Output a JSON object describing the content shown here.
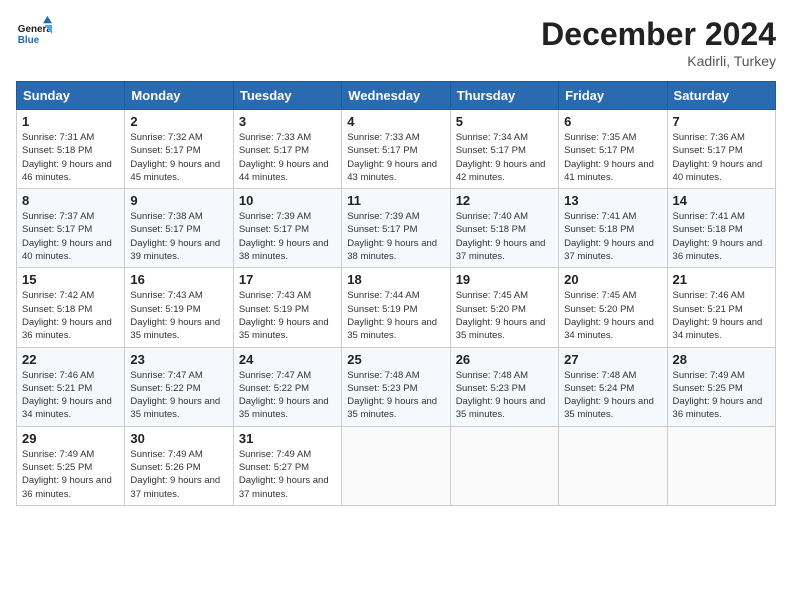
{
  "header": {
    "logo_line1": "General",
    "logo_line2": "Blue",
    "month": "December 2024",
    "location": "Kadirli, Turkey"
  },
  "days_of_week": [
    "Sunday",
    "Monday",
    "Tuesday",
    "Wednesday",
    "Thursday",
    "Friday",
    "Saturday"
  ],
  "weeks": [
    [
      {
        "day": "1",
        "sunrise": "Sunrise: 7:31 AM",
        "sunset": "Sunset: 5:18 PM",
        "daylight": "Daylight: 9 hours and 46 minutes."
      },
      {
        "day": "2",
        "sunrise": "Sunrise: 7:32 AM",
        "sunset": "Sunset: 5:17 PM",
        "daylight": "Daylight: 9 hours and 45 minutes."
      },
      {
        "day": "3",
        "sunrise": "Sunrise: 7:33 AM",
        "sunset": "Sunset: 5:17 PM",
        "daylight": "Daylight: 9 hours and 44 minutes."
      },
      {
        "day": "4",
        "sunrise": "Sunrise: 7:33 AM",
        "sunset": "Sunset: 5:17 PM",
        "daylight": "Daylight: 9 hours and 43 minutes."
      },
      {
        "day": "5",
        "sunrise": "Sunrise: 7:34 AM",
        "sunset": "Sunset: 5:17 PM",
        "daylight": "Daylight: 9 hours and 42 minutes."
      },
      {
        "day": "6",
        "sunrise": "Sunrise: 7:35 AM",
        "sunset": "Sunset: 5:17 PM",
        "daylight": "Daylight: 9 hours and 41 minutes."
      },
      {
        "day": "7",
        "sunrise": "Sunrise: 7:36 AM",
        "sunset": "Sunset: 5:17 PM",
        "daylight": "Daylight: 9 hours and 40 minutes."
      }
    ],
    [
      {
        "day": "8",
        "sunrise": "Sunrise: 7:37 AM",
        "sunset": "Sunset: 5:17 PM",
        "daylight": "Daylight: 9 hours and 40 minutes."
      },
      {
        "day": "9",
        "sunrise": "Sunrise: 7:38 AM",
        "sunset": "Sunset: 5:17 PM",
        "daylight": "Daylight: 9 hours and 39 minutes."
      },
      {
        "day": "10",
        "sunrise": "Sunrise: 7:39 AM",
        "sunset": "Sunset: 5:17 PM",
        "daylight": "Daylight: 9 hours and 38 minutes."
      },
      {
        "day": "11",
        "sunrise": "Sunrise: 7:39 AM",
        "sunset": "Sunset: 5:17 PM",
        "daylight": "Daylight: 9 hours and 38 minutes."
      },
      {
        "day": "12",
        "sunrise": "Sunrise: 7:40 AM",
        "sunset": "Sunset: 5:18 PM",
        "daylight": "Daylight: 9 hours and 37 minutes."
      },
      {
        "day": "13",
        "sunrise": "Sunrise: 7:41 AM",
        "sunset": "Sunset: 5:18 PM",
        "daylight": "Daylight: 9 hours and 37 minutes."
      },
      {
        "day": "14",
        "sunrise": "Sunrise: 7:41 AM",
        "sunset": "Sunset: 5:18 PM",
        "daylight": "Daylight: 9 hours and 36 minutes."
      }
    ],
    [
      {
        "day": "15",
        "sunrise": "Sunrise: 7:42 AM",
        "sunset": "Sunset: 5:18 PM",
        "daylight": "Daylight: 9 hours and 36 minutes."
      },
      {
        "day": "16",
        "sunrise": "Sunrise: 7:43 AM",
        "sunset": "Sunset: 5:19 PM",
        "daylight": "Daylight: 9 hours and 35 minutes."
      },
      {
        "day": "17",
        "sunrise": "Sunrise: 7:43 AM",
        "sunset": "Sunset: 5:19 PM",
        "daylight": "Daylight: 9 hours and 35 minutes."
      },
      {
        "day": "18",
        "sunrise": "Sunrise: 7:44 AM",
        "sunset": "Sunset: 5:19 PM",
        "daylight": "Daylight: 9 hours and 35 minutes."
      },
      {
        "day": "19",
        "sunrise": "Sunrise: 7:45 AM",
        "sunset": "Sunset: 5:20 PM",
        "daylight": "Daylight: 9 hours and 35 minutes."
      },
      {
        "day": "20",
        "sunrise": "Sunrise: 7:45 AM",
        "sunset": "Sunset: 5:20 PM",
        "daylight": "Daylight: 9 hours and 34 minutes."
      },
      {
        "day": "21",
        "sunrise": "Sunrise: 7:46 AM",
        "sunset": "Sunset: 5:21 PM",
        "daylight": "Daylight: 9 hours and 34 minutes."
      }
    ],
    [
      {
        "day": "22",
        "sunrise": "Sunrise: 7:46 AM",
        "sunset": "Sunset: 5:21 PM",
        "daylight": "Daylight: 9 hours and 34 minutes."
      },
      {
        "day": "23",
        "sunrise": "Sunrise: 7:47 AM",
        "sunset": "Sunset: 5:22 PM",
        "daylight": "Daylight: 9 hours and 35 minutes."
      },
      {
        "day": "24",
        "sunrise": "Sunrise: 7:47 AM",
        "sunset": "Sunset: 5:22 PM",
        "daylight": "Daylight: 9 hours and 35 minutes."
      },
      {
        "day": "25",
        "sunrise": "Sunrise: 7:48 AM",
        "sunset": "Sunset: 5:23 PM",
        "daylight": "Daylight: 9 hours and 35 minutes."
      },
      {
        "day": "26",
        "sunrise": "Sunrise: 7:48 AM",
        "sunset": "Sunset: 5:23 PM",
        "daylight": "Daylight: 9 hours and 35 minutes."
      },
      {
        "day": "27",
        "sunrise": "Sunrise: 7:48 AM",
        "sunset": "Sunset: 5:24 PM",
        "daylight": "Daylight: 9 hours and 35 minutes."
      },
      {
        "day": "28",
        "sunrise": "Sunrise: 7:49 AM",
        "sunset": "Sunset: 5:25 PM",
        "daylight": "Daylight: 9 hours and 36 minutes."
      }
    ],
    [
      {
        "day": "29",
        "sunrise": "Sunrise: 7:49 AM",
        "sunset": "Sunset: 5:25 PM",
        "daylight": "Daylight: 9 hours and 36 minutes."
      },
      {
        "day": "30",
        "sunrise": "Sunrise: 7:49 AM",
        "sunset": "Sunset: 5:26 PM",
        "daylight": "Daylight: 9 hours and 37 minutes."
      },
      {
        "day": "31",
        "sunrise": "Sunrise: 7:49 AM",
        "sunset": "Sunset: 5:27 PM",
        "daylight": "Daylight: 9 hours and 37 minutes."
      },
      null,
      null,
      null,
      null
    ]
  ]
}
